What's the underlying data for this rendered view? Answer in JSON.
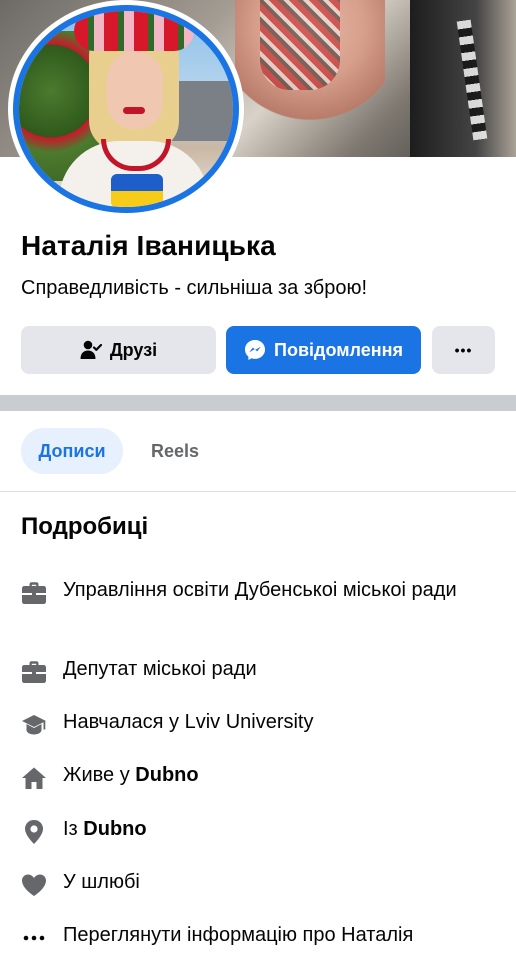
{
  "profile": {
    "name": "Наталія Іваницька",
    "bio": "Справедливість - сильніша за зброю!"
  },
  "actions": {
    "friends_label": "Друзі",
    "message_label": "Повідомлення",
    "more_label": "•••"
  },
  "tabs": [
    {
      "label": "Дописи",
      "active": true
    },
    {
      "label": "Reels",
      "active": false
    }
  ],
  "details": {
    "title": "Подробиці",
    "items": [
      {
        "icon": "briefcase-icon",
        "text": "Управління освіти Дубенськоі міськоі ради"
      },
      {
        "icon": "briefcase-icon",
        "text": "Депутат міськоі ради"
      },
      {
        "icon": "graduation-cap-icon",
        "text": "Навчалася у Lviv University"
      },
      {
        "icon": "home-icon",
        "prefix": "Живе у ",
        "bold": "Dubno"
      },
      {
        "icon": "location-pin-icon",
        "prefix": "Із ",
        "bold": "Dubno"
      },
      {
        "icon": "heart-icon",
        "text": "У шлюбі"
      },
      {
        "icon": "more-dots-icon",
        "text": "Переглянути інформацію про Наталія"
      }
    ]
  },
  "colors": {
    "accent": "#1b74e4",
    "button_gray": "#e4e6eb",
    "tab_active_bg": "#e7f0fd",
    "icon_gray": "#65676b"
  }
}
